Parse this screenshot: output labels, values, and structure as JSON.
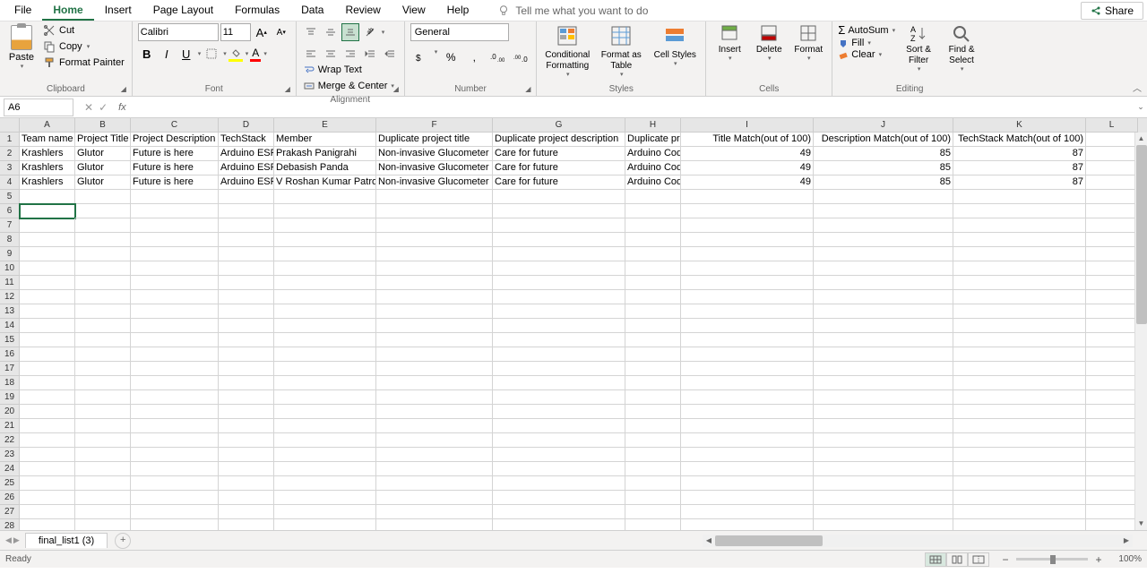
{
  "menu": {
    "items": [
      "File",
      "Home",
      "Insert",
      "Page Layout",
      "Formulas",
      "Data",
      "Review",
      "View",
      "Help"
    ],
    "active_index": 1,
    "tell_me": "Tell me what you want to do",
    "share": "Share"
  },
  "ribbon": {
    "clipboard": {
      "paste": "Paste",
      "cut": "Cut",
      "copy": "Copy",
      "painter": "Format Painter",
      "label": "Clipboard"
    },
    "font": {
      "name": "Calibri",
      "size": "11",
      "label": "Font"
    },
    "alignment": {
      "wrap": "Wrap Text",
      "merge": "Merge & Center",
      "label": "Alignment"
    },
    "number": {
      "format": "General",
      "label": "Number"
    },
    "styles": {
      "cond": "Conditional Formatting",
      "table": "Format as Table",
      "cell": "Cell Styles",
      "label": "Styles"
    },
    "cells": {
      "insert": "Insert",
      "delete": "Delete",
      "format": "Format",
      "label": "Cells"
    },
    "editing": {
      "autosum": "AutoSum",
      "fill": "Fill",
      "clear": "Clear",
      "sort": "Sort & Filter",
      "find": "Find & Select",
      "label": "Editing"
    }
  },
  "namebox": "A6",
  "formula": "",
  "columns": [
    {
      "letter": "A",
      "width": 62
    },
    {
      "letter": "B",
      "width": 62
    },
    {
      "letter": "C",
      "width": 98
    },
    {
      "letter": "D",
      "width": 62
    },
    {
      "letter": "E",
      "width": 114
    },
    {
      "letter": "F",
      "width": 130
    },
    {
      "letter": "G",
      "width": 148
    },
    {
      "letter": "H",
      "width": 62
    },
    {
      "letter": "I",
      "width": 148
    },
    {
      "letter": "J",
      "width": 156
    },
    {
      "letter": "K",
      "width": 148
    },
    {
      "letter": "L",
      "width": 58
    }
  ],
  "row_count": 29,
  "selected_cell": {
    "row": 6,
    "col": 0
  },
  "data_rows": [
    [
      "Team name",
      "Project Title",
      "Project Description",
      "TechStack",
      "Member",
      "Duplicate project title",
      "Duplicate project description",
      "Duplicate project TechStack",
      "Title Match(out of 100)",
      "Description Match(out of 100)",
      "TechStack Match(out of 100)",
      ""
    ],
    [
      "Krashlers",
      "Glutor",
      "Future is here",
      "Arduino ESP",
      "Prakash Panigrahi",
      "Non-invasive Glucometer",
      "Care for future",
      "Arduino Coding",
      "49",
      "85",
      "87",
      ""
    ],
    [
      "Krashlers",
      "Glutor",
      "Future is here",
      "Arduino ESP",
      "Debasish Panda",
      "Non-invasive Glucometer",
      "Care for future",
      "Arduino Coding",
      "49",
      "85",
      "87",
      ""
    ],
    [
      "Krashlers",
      "Glutor",
      "Future is here",
      "Arduino ESP",
      "V Roshan Kumar Patro",
      "Non-invasive Glucometer",
      "Care for future",
      "Arduino Coding",
      "49",
      "85",
      "87",
      ""
    ]
  ],
  "numeric_cols": [
    8,
    9,
    10
  ],
  "sheet_tab": "final_list1 (3)",
  "status": "Ready",
  "zoom": "100%"
}
